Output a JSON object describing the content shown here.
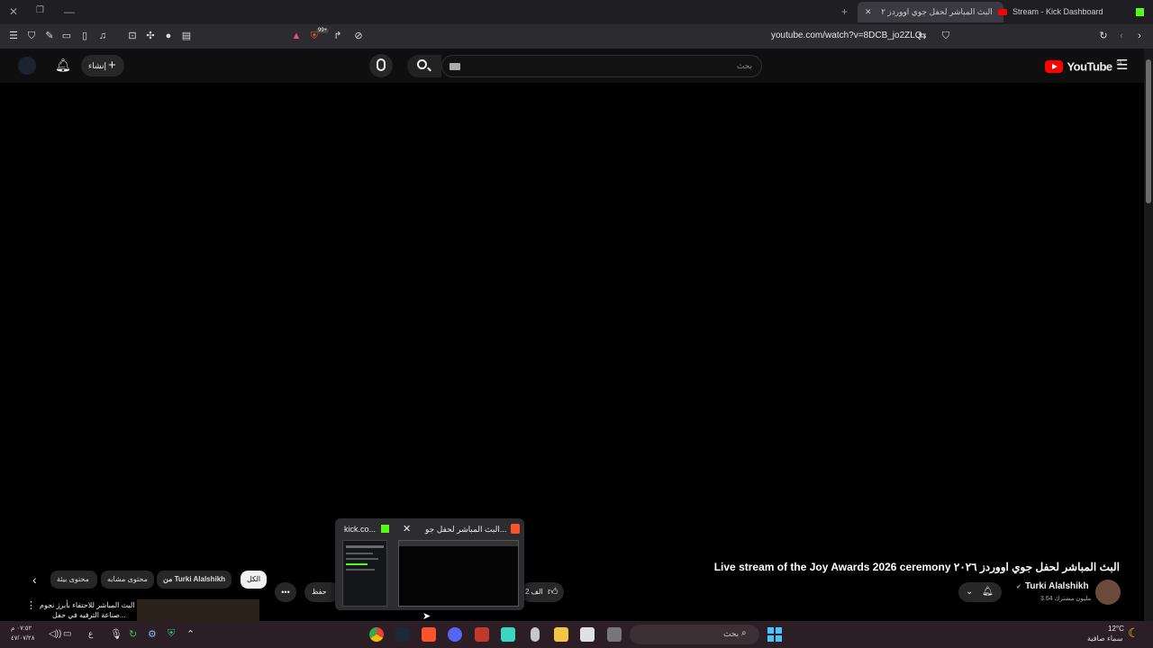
{
  "browser": {
    "tabs": [
      {
        "label": "البث المباشر لحفل جوي اووردز ٢",
        "active": true
      },
      {
        "label": "Stream - Kick Dashboard",
        "active": false
      }
    ],
    "url": "youtube.com/watch?v=8DCB_jo2ZLQ",
    "shield_badge": "99+"
  },
  "youtube": {
    "logo_text": "YouTube",
    "region": "SA",
    "search_placeholder": "بحث",
    "create_label": "إنشاء"
  },
  "video": {
    "title": "Live stream of the Joy Awards 2026 ceremony البث المباشر لحفل جوي اووردز ٢٠٢٦",
    "channel": "Turki Alalshikh",
    "subscribers": "3.64 مليون مشترك",
    "likes": "2 الف",
    "save_label": "حفظ",
    "more_label": "•••"
  },
  "chips": [
    {
      "label": "الكل",
      "active": true
    },
    {
      "label": "من Turki Alalshikh"
    },
    {
      "label": "محتوى مشابه"
    },
    {
      "label": "محتوى بيئة"
    }
  ],
  "recommendation": {
    "line1": "البث المباشر للاحتفاء بأبرز نجوم",
    "line2": "صناعة الترفيه في حفل..."
  },
  "popup": {
    "item1_label": "kick.co...",
    "item2_label": "البث المباشر لحفل جو..."
  },
  "taskbar": {
    "search_placeholder": "بحث",
    "weather_temp": "12°C",
    "weather_desc": "سماء صافية",
    "time": "٠٧:٥٢ م",
    "date": "٤٧/٠٧/٢٨",
    "lang": "ع"
  },
  "colors": {
    "youtube_red": "#ff0000",
    "kick_green": "#53fc18",
    "brave_orange": "#fb542b"
  }
}
